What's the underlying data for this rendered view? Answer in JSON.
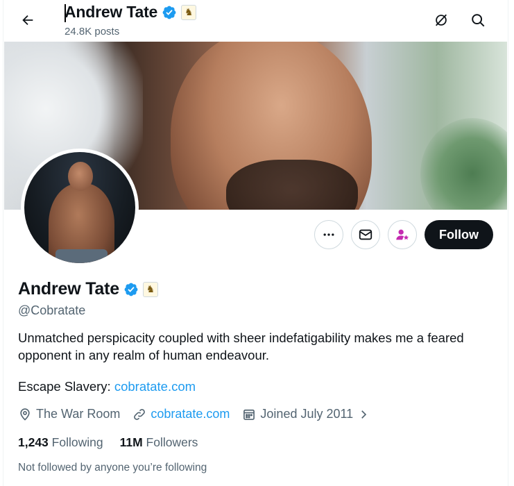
{
  "header": {
    "name": "Andrew Tate",
    "posts": "24.8K posts"
  },
  "icons": {
    "back": "arrow-left-icon",
    "grok": "grok-icon",
    "search": "search-icon",
    "more": "more-dots-icon",
    "message": "envelope-icon",
    "subscribe": "person-star-icon",
    "location": "location-pin-icon",
    "website": "link-icon",
    "joined": "calendar-icon",
    "verified": "verified-badge-icon",
    "affiliate": "knight-badge-icon"
  },
  "profile": {
    "name": "Andrew Tate",
    "handle": "@Cobratate",
    "bio": "Unmatched perspicacity coupled with sheer indefatigability makes me a feared opponent in any realm of human endeavour.",
    "escape_label": "Escape Slavery: ",
    "escape_link": "cobratate.com",
    "location": "The War Room",
    "website": "cobratate.com",
    "joined": "Joined July 2011",
    "following_count": "1,243",
    "following_label": "Following",
    "followers_count": "11M",
    "followers_label": "Followers",
    "not_followed": "Not followed by anyone you’re following"
  },
  "actions": {
    "follow_label": "Follow"
  },
  "colors": {
    "accent": "#1d9bf0",
    "text": "#0f1419",
    "secondary": "#536471",
    "follow_bg": "#0f1419",
    "subscribe": "#c42bb0"
  }
}
